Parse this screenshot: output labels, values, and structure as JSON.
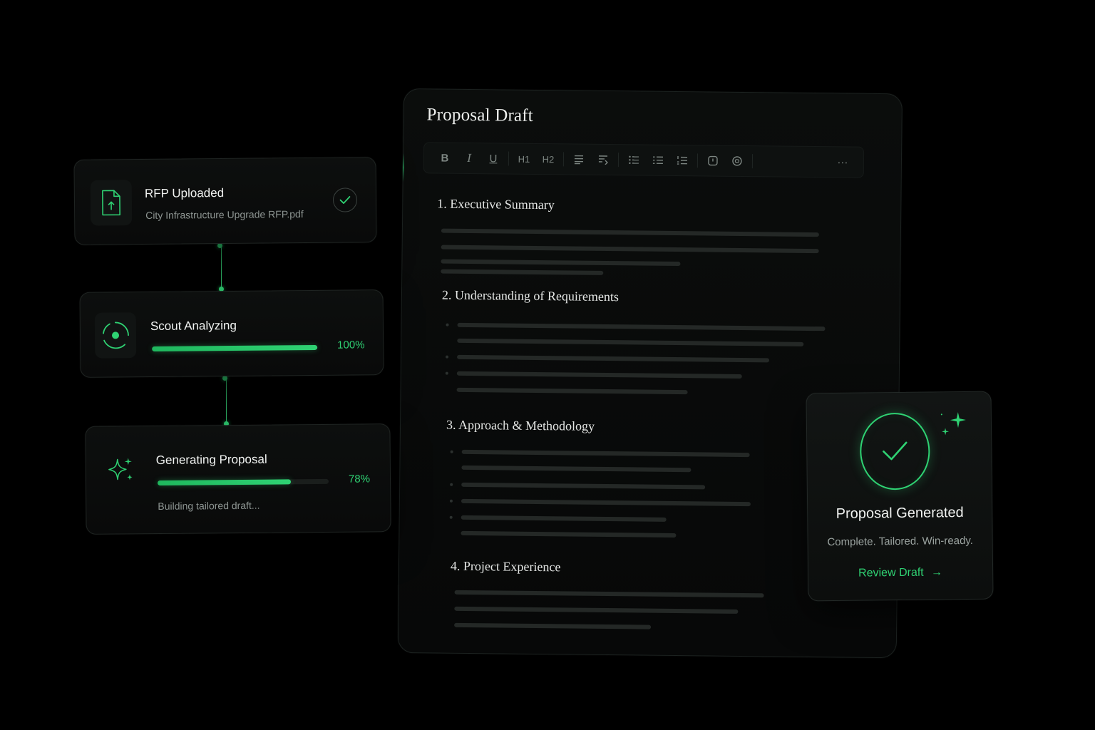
{
  "steps": [
    {
      "title": "RFP Uploaded",
      "subtitle": "City Infrastructure Upgrade RFP.pdf",
      "icon": "file-upload-icon",
      "status": "complete"
    },
    {
      "title": "Scout Analyzing",
      "progress": 1.0,
      "progress_label": "100%",
      "icon": "target-icon"
    },
    {
      "title": "Generating Proposal",
      "progress": 0.78,
      "progress_label": "78%",
      "subtitle": "Building tailored draft...",
      "icon": "sparkle-icon"
    }
  ],
  "editor": {
    "title": "Proposal Draft",
    "toolbar": {
      "bold": "B",
      "italic": "I",
      "underline": "U",
      "h1": "H1",
      "h2": "H2",
      "more": "···"
    },
    "sections": [
      {
        "heading": "1. Executive Summary"
      },
      {
        "heading": "2. Understanding of Requirements"
      },
      {
        "heading": "3. Approach & Methodology"
      },
      {
        "heading": "4. Project Experience"
      }
    ]
  },
  "success": {
    "title": "Proposal Generated",
    "subtitle": "Complete. Tailored. Win-ready.",
    "link": "Review Draft",
    "link_arrow": "→"
  },
  "colors": {
    "accent": "#2fd273",
    "background": "#000000",
    "card": "#0c0e0d",
    "border": "#1f2422",
    "placeholder_line": "#242826"
  }
}
